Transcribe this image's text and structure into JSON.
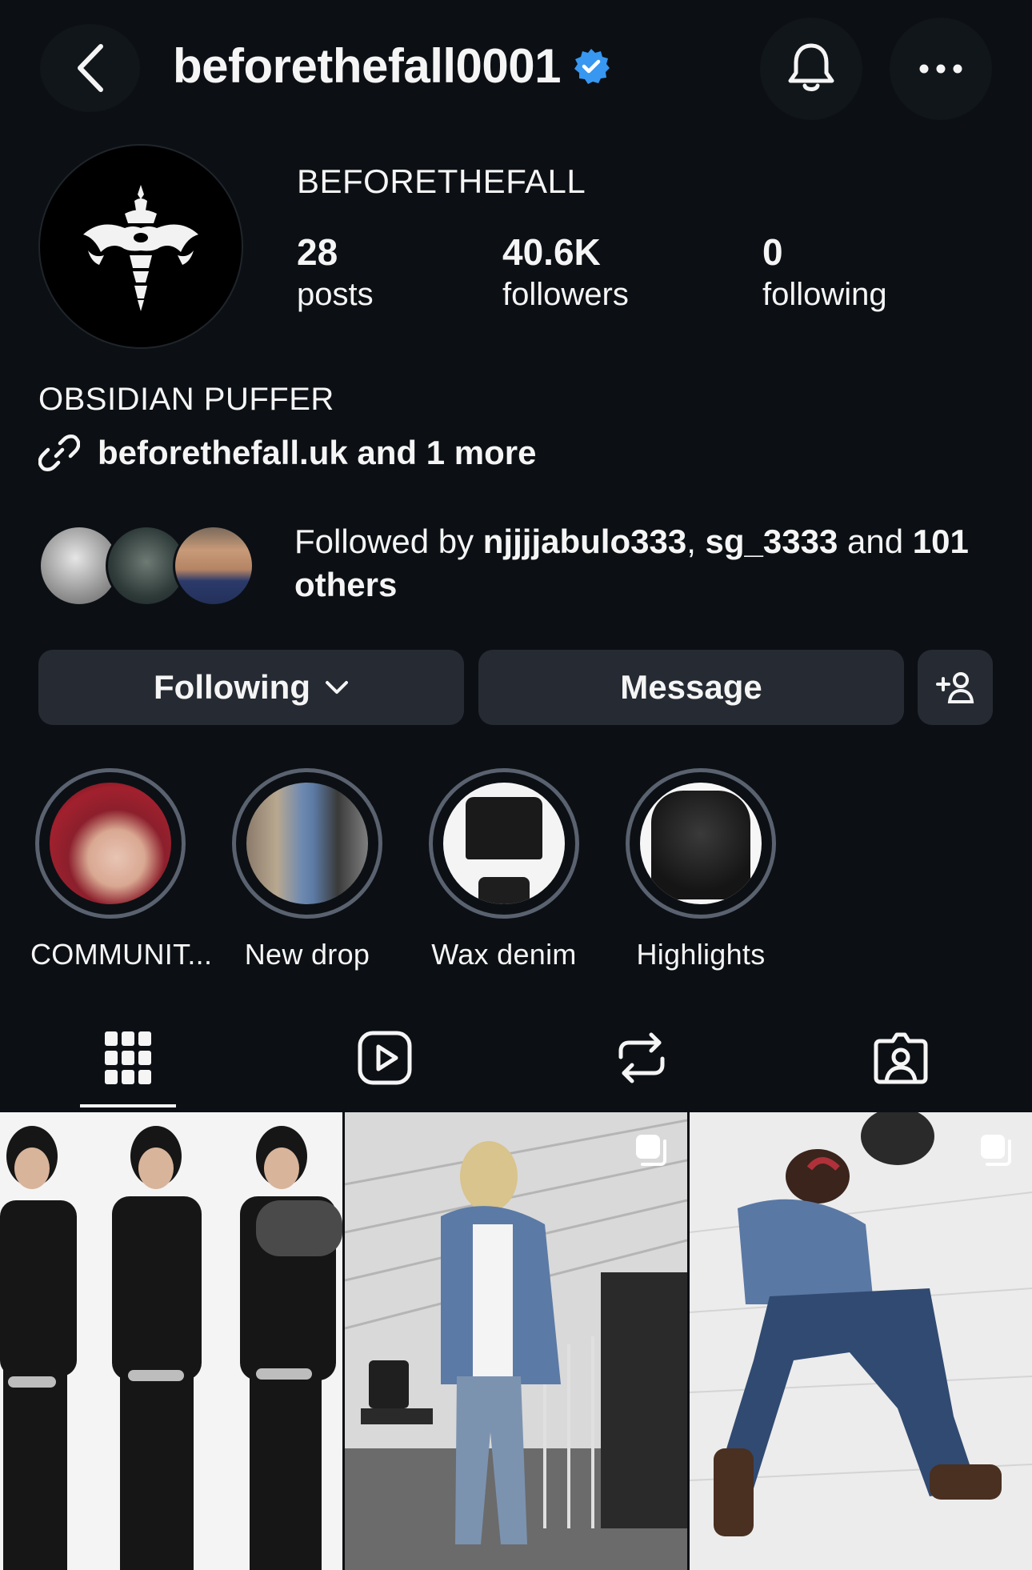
{
  "header": {
    "username": "beforethefall0001",
    "verified": true,
    "icons": [
      "back-icon",
      "verified-badge-icon",
      "bell-icon",
      "more-icon"
    ]
  },
  "profile": {
    "display_name": "BEFORETHEFALL",
    "stats": [
      {
        "value": "28",
        "label": "posts"
      },
      {
        "value": "40.6K",
        "label": "followers"
      },
      {
        "value": "0",
        "label": "following"
      }
    ],
    "bio": "OBSIDIAN PUFFER",
    "link": "beforethefall.uk and 1 more"
  },
  "followed_by": {
    "prefix": "Followed by ",
    "user1": "njjjjabulo333",
    "sep": ", ",
    "user2": "sg_3333",
    "and": " and ",
    "count": "101",
    "others": "others"
  },
  "actions": {
    "following_label": "Following",
    "message_label": "Message"
  },
  "highlights": [
    {
      "label": "COMMUNIT..."
    },
    {
      "label": "New drop"
    },
    {
      "label": "Wax denim"
    },
    {
      "label": "Highlights"
    }
  ],
  "tabs": [
    "grid-icon",
    "reels-icon",
    "reposts-icon",
    "tagged-icon"
  ],
  "colors": {
    "background": "#0c1014",
    "button": "#262b33",
    "verified": "#3897f0"
  }
}
